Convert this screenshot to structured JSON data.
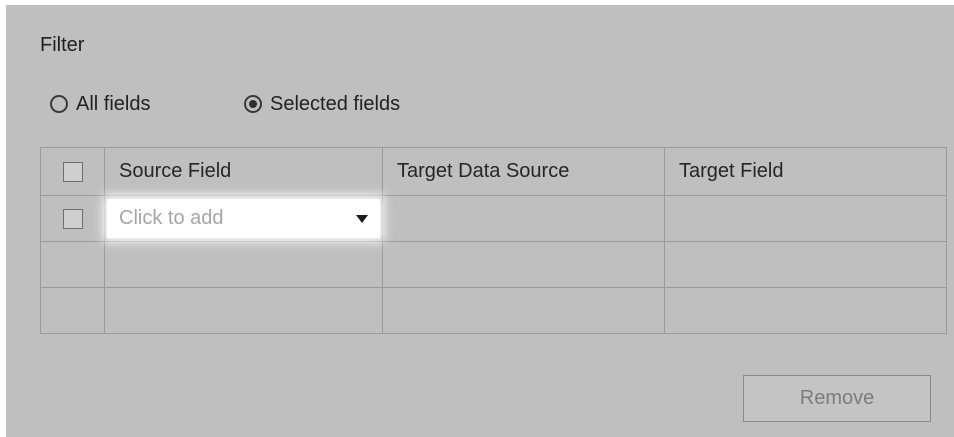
{
  "filter": {
    "title": "Filter",
    "options": [
      {
        "label": "All fields",
        "selected": false
      },
      {
        "label": "Selected fields",
        "selected": true
      }
    ]
  },
  "table": {
    "headers": [
      "Source Field",
      "Target Data Source",
      "Target Field"
    ],
    "rows": [
      {
        "source_field_placeholder": "Click to add",
        "target_data_source": "",
        "target_field": ""
      },
      {
        "source_field": "",
        "target_data_source": "",
        "target_field": ""
      },
      {
        "source_field": "",
        "target_data_source": "",
        "target_field": ""
      }
    ]
  },
  "actions": {
    "remove_label": "Remove",
    "remove_enabled": false
  },
  "icons": {
    "dropdown": "chevron-down-icon",
    "radio_unselected": "radio-unchecked-icon",
    "radio_selected": "radio-checked-icon",
    "checkbox": "checkbox-icon"
  },
  "colors": {
    "panel_background": "#bfbfbf",
    "dropdown_background": "#ffffff",
    "placeholder_text": "#a5a5a5",
    "disabled_text": "#7c7c7c"
  }
}
